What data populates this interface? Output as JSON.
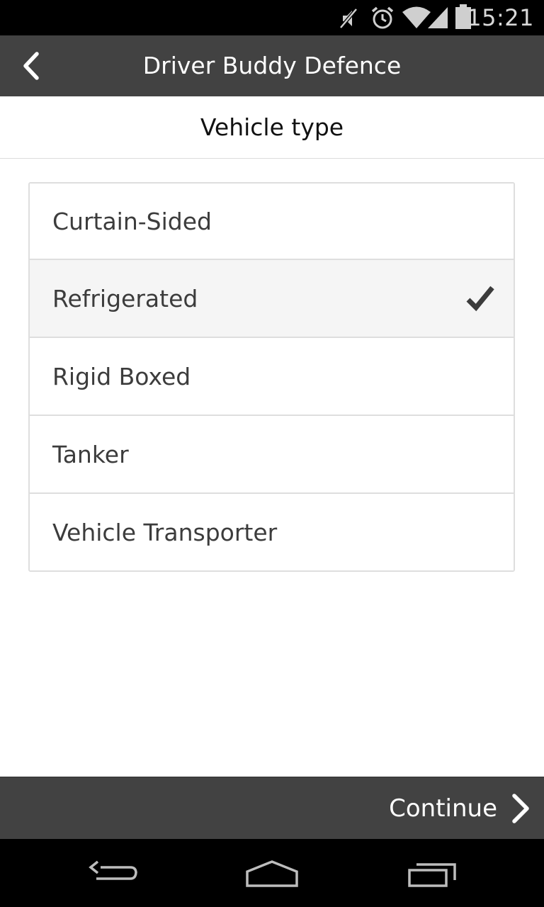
{
  "status_bar": {
    "time": "15:21",
    "icons": [
      "mute-icon",
      "alarm-icon",
      "wifi-icon",
      "signal-icon",
      "battery-icon"
    ]
  },
  "app_bar": {
    "title": "Driver Buddy Defence",
    "back_icon": "chevron-left-icon"
  },
  "page": {
    "title": "Vehicle type"
  },
  "options": [
    {
      "label": "Curtain-Sided",
      "selected": false
    },
    {
      "label": "Refrigerated",
      "selected": true
    },
    {
      "label": "Rigid Boxed",
      "selected": false
    },
    {
      "label": "Tanker",
      "selected": false
    },
    {
      "label": "Vehicle Transporter",
      "selected": false
    }
  ],
  "bottom_bar": {
    "continue_label": "Continue",
    "continue_icon": "chevron-right-icon"
  },
  "nav_bar": {
    "buttons": [
      "back-nav-icon",
      "home-nav-icon",
      "recents-nav-icon"
    ]
  },
  "colors": {
    "app_bar": "#424242",
    "status_bar": "#000000",
    "selected_row": "#f5f5f5",
    "check": "#3c3c3c"
  }
}
